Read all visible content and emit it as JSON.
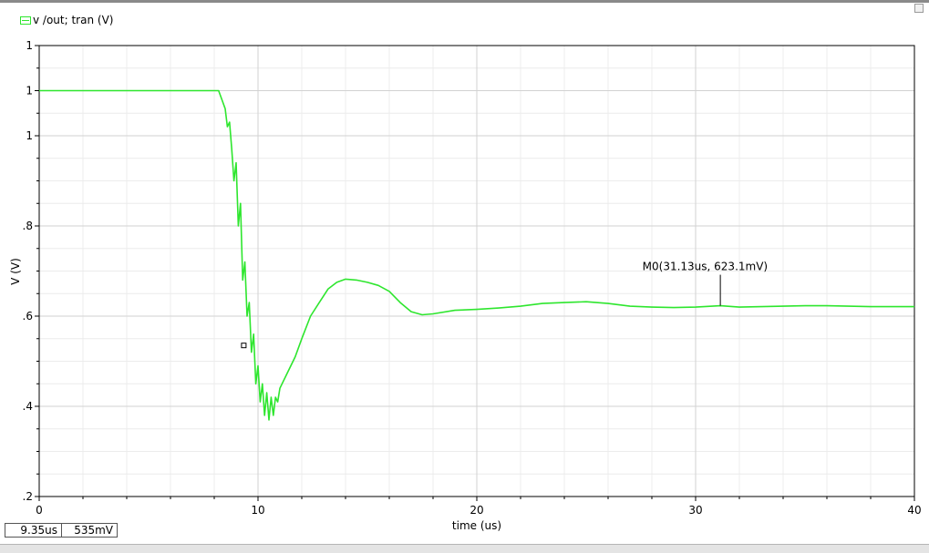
{
  "legend": {
    "label": "v /out; tran (V)",
    "color": "#2ee62e"
  },
  "status": {
    "x_readout": "9.35us",
    "y_readout": "535mV"
  },
  "chart_data": {
    "type": "line",
    "title": "",
    "xlabel": "time (us)",
    "ylabel": "V (V)",
    "xlim": [
      0,
      40
    ],
    "ylim": [
      0.2,
      1.2
    ],
    "x_ticks": [
      0,
      10,
      20,
      30,
      40
    ],
    "x_tick_labels": [
      "0",
      "10",
      "20",
      "30",
      "40"
    ],
    "y_ticks": [
      0.2,
      0.4,
      0.6,
      0.8,
      1.0,
      1.1,
      1.2
    ],
    "y_tick_labels": [
      ".2",
      ".4",
      ".6",
      ".8",
      "1",
      "1",
      "1"
    ],
    "grid": true,
    "series": [
      {
        "name": "v /out; tran (V)",
        "color": "#2ee62e",
        "x": [
          0,
          8.2,
          8.35,
          8.5,
          8.6,
          8.7,
          8.8,
          8.9,
          9.0,
          9.1,
          9.2,
          9.3,
          9.4,
          9.5,
          9.6,
          9.7,
          9.8,
          9.9,
          10.0,
          10.1,
          10.2,
          10.3,
          10.4,
          10.5,
          10.6,
          10.7,
          10.8,
          10.9,
          11.0,
          11.3,
          11.7,
          12.0,
          12.4,
          12.8,
          13.2,
          13.6,
          14.0,
          14.5,
          15.0,
          15.5,
          16.0,
          16.5,
          17.0,
          17.5,
          18.0,
          19.0,
          20.0,
          21.0,
          22.0,
          23.0,
          24.0,
          25.0,
          26.0,
          27.0,
          28.0,
          29.0,
          30.0,
          31.13,
          32.0,
          33.0,
          34.0,
          35.0,
          36.0,
          37.0,
          38.0,
          39.0,
          40.0
        ],
        "y": [
          1.1,
          1.1,
          1.08,
          1.06,
          1.02,
          1.03,
          0.97,
          0.9,
          0.94,
          0.8,
          0.85,
          0.68,
          0.72,
          0.6,
          0.63,
          0.52,
          0.56,
          0.45,
          0.49,
          0.41,
          0.45,
          0.38,
          0.43,
          0.37,
          0.42,
          0.38,
          0.42,
          0.41,
          0.44,
          0.47,
          0.51,
          0.55,
          0.6,
          0.63,
          0.66,
          0.675,
          0.682,
          0.68,
          0.675,
          0.668,
          0.655,
          0.63,
          0.61,
          0.603,
          0.605,
          0.613,
          0.615,
          0.618,
          0.622,
          0.628,
          0.63,
          0.632,
          0.628,
          0.622,
          0.62,
          0.619,
          0.62,
          0.6231,
          0.62,
          0.621,
          0.622,
          0.623,
          0.623,
          0.622,
          0.621,
          0.621,
          0.621
        ]
      }
    ],
    "annotations": [
      {
        "name": "M0",
        "label": "M0(31.13us, 623.1mV)",
        "x": 31.13,
        "y": 0.6231
      }
    ],
    "cursor": {
      "x": 9.35,
      "y": 0.535
    }
  }
}
